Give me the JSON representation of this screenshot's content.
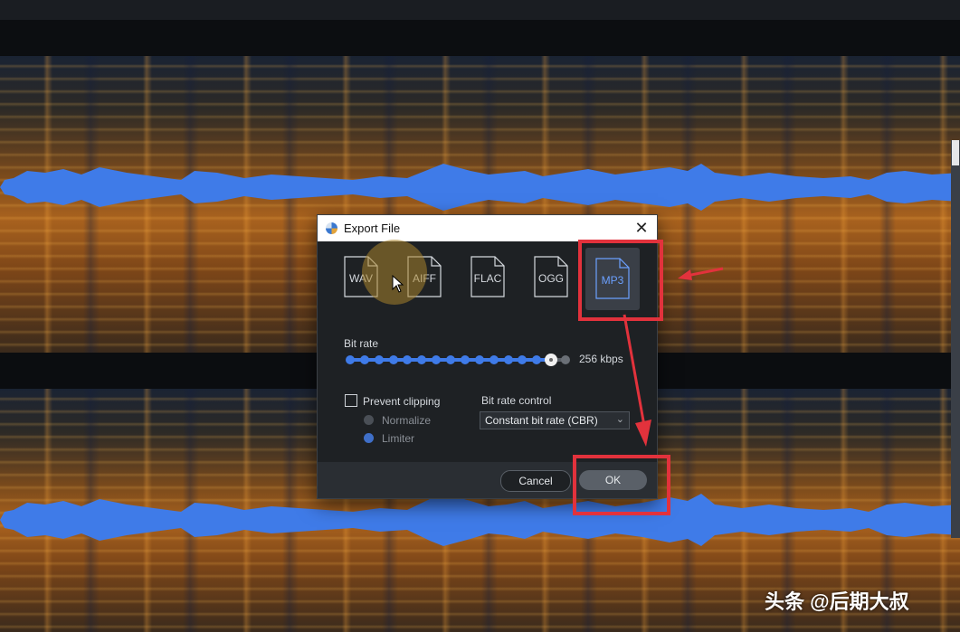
{
  "dialog": {
    "title": "Export File",
    "formats": [
      {
        "label": "WAV",
        "selected": false
      },
      {
        "label": "AIFF",
        "selected": false
      },
      {
        "label": "FLAC",
        "selected": false
      },
      {
        "label": "OGG",
        "selected": false
      },
      {
        "label": "MP3",
        "selected": true
      }
    ],
    "bitrate": {
      "label": "Bit rate",
      "value": "256 kbps",
      "steps": 16,
      "selected_step": 14
    },
    "prevent_clipping": {
      "label": "Prevent clipping",
      "checked": false,
      "options": [
        {
          "label": "Normalize",
          "selected": false
        },
        {
          "label": "Limiter",
          "selected": true
        }
      ]
    },
    "bitrate_control": {
      "label": "Bit rate control",
      "value": "Constant bit rate (CBR)"
    },
    "buttons": {
      "cancel": "Cancel",
      "ok": "OK"
    }
  },
  "watermark": "头条 @后期大叔",
  "colors": {
    "accent": "#3f7be8",
    "annotation": "#e2323c",
    "waveform": "#3f7be8",
    "spectrogram": "#a9621e"
  },
  "icons": [
    "app-icon",
    "close-icon",
    "file-icon",
    "chevron-down-icon",
    "cursor-icon",
    "arrow-icon"
  ]
}
